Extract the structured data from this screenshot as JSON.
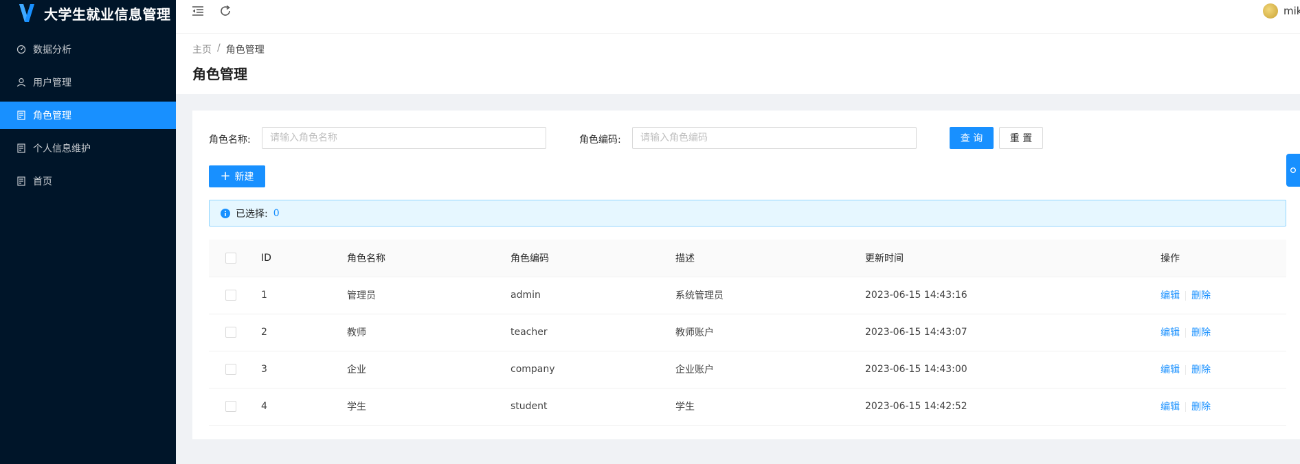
{
  "app": {
    "title": "大学生就业信息管理"
  },
  "sidebar": {
    "items": [
      {
        "label": "数据分析",
        "icon": "dashboard-icon",
        "active": false
      },
      {
        "label": "用户管理",
        "icon": "user-icon",
        "active": false
      },
      {
        "label": "角色管理",
        "icon": "form-icon",
        "active": true
      },
      {
        "label": "个人信息维护",
        "icon": "form-icon",
        "active": false
      },
      {
        "label": "首页",
        "icon": "form-icon",
        "active": false
      }
    ]
  },
  "header": {
    "username": "mik"
  },
  "breadcrumb": {
    "home": "主页",
    "separator": "/",
    "current": "角色管理"
  },
  "page": {
    "title": "角色管理"
  },
  "search": {
    "name_label": "角色名称:",
    "name_placeholder": "请输入角色名称",
    "code_label": "角色编码:",
    "code_placeholder": "请输入角色编码",
    "query_label": "查 询",
    "reset_label": "重 置"
  },
  "toolbar": {
    "new_label": "新建"
  },
  "selection": {
    "label": "已选择:",
    "count": "0"
  },
  "table": {
    "columns": [
      "ID",
      "角色名称",
      "角色编码",
      "描述",
      "更新时间",
      "操作"
    ],
    "rows": [
      {
        "id": "1",
        "name": "管理员",
        "code": "admin",
        "desc": "系统管理员",
        "updated": "2023-06-15 14:43:16"
      },
      {
        "id": "2",
        "name": "教师",
        "code": "teacher",
        "desc": "教师账户",
        "updated": "2023-06-15 14:43:07"
      },
      {
        "id": "3",
        "name": "企业",
        "code": "company",
        "desc": "企业账户",
        "updated": "2023-06-15 14:43:00"
      },
      {
        "id": "4",
        "name": "学生",
        "code": "student",
        "desc": "学生",
        "updated": "2023-06-15 14:42:52"
      }
    ],
    "edit_label": "编辑",
    "delete_label": "删除"
  },
  "colors": {
    "primary": "#1890ff",
    "sidebar_bg": "#001529"
  }
}
